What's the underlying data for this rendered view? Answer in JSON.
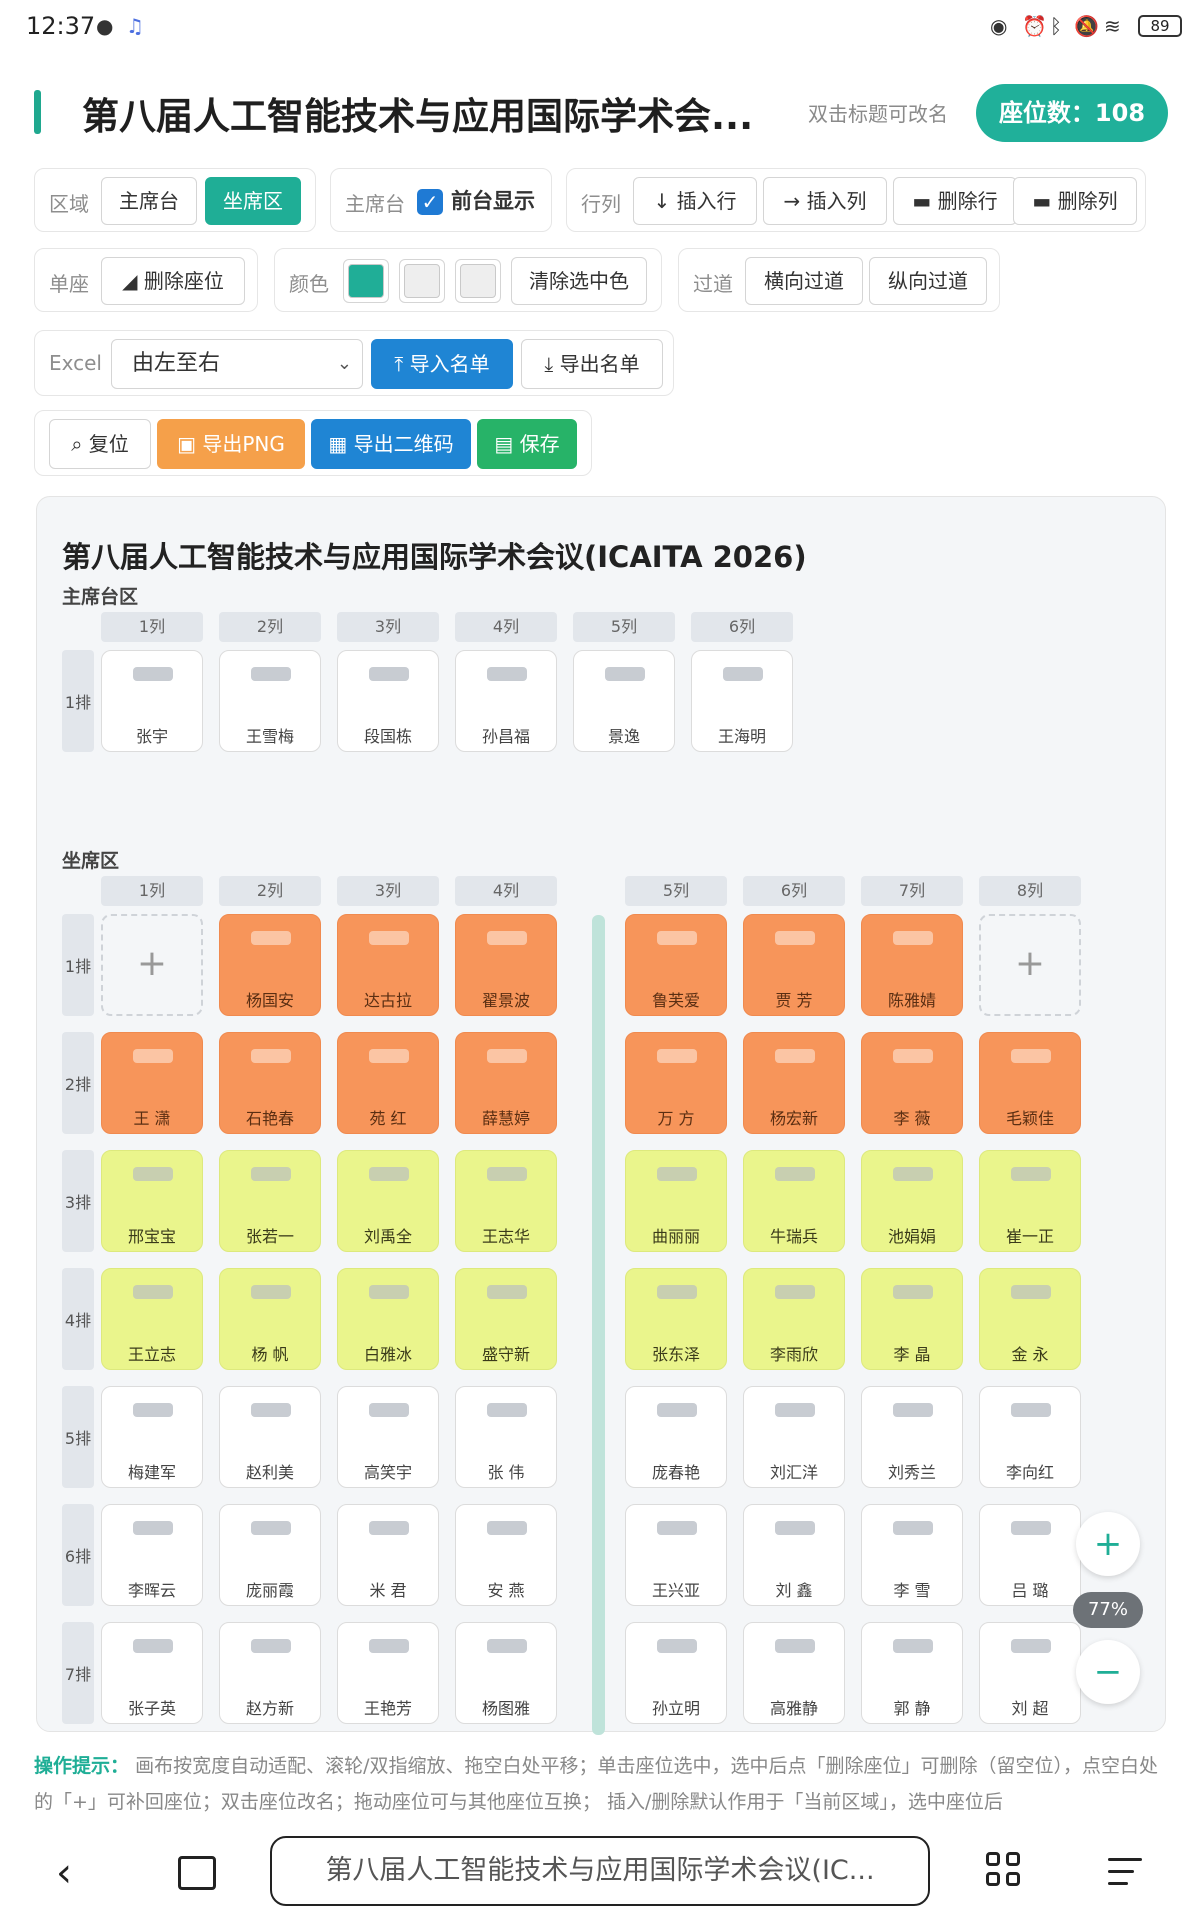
{
  "status_bar": {
    "time": "12:37",
    "battery": "89"
  },
  "header": {
    "title": "第八届人工智能技术与应用国际学术会...",
    "rename_hint": "双击标题可改名",
    "seat_count": "座位数：108"
  },
  "toolbar": {
    "area_label": "区域",
    "area_options": [
      "主席台",
      "坐席区"
    ],
    "stage_label": "主席台",
    "front_display": "前台显示",
    "rowcol_label": "行列",
    "insert_row": "插入行",
    "insert_col": "插入列",
    "delete_row": "删除行",
    "delete_col": "删除列",
    "single_label": "单座",
    "delete_seat": "删除座位",
    "color_label": "颜色",
    "colors": [
      "#20ae97",
      "#eeeeee",
      "#eeeeee"
    ],
    "clear_color": "清除选中色",
    "aisle_label": "过道",
    "h_aisle": "横向过道",
    "v_aisle": "纵向过道",
    "excel_label": "Excel",
    "direction": "由左至右",
    "import_list": "导入名单",
    "export_list": "导出名单",
    "reset": "复位",
    "export_png": "导出PNG",
    "export_qr": "导出二维码",
    "save": "保存"
  },
  "canvas": {
    "title": "第八届人工智能技术与应用国际学术会议(ICAITA 2026)",
    "stage": {
      "label": "主席台区",
      "columns": [
        "1列",
        "2列",
        "3列",
        "4列",
        "5列",
        "6列"
      ],
      "rows": [
        {
          "label": "1排",
          "seats": [
            {
              "name": "张宇",
              "color": "white"
            },
            {
              "name": "王雪梅",
              "color": "white"
            },
            {
              "name": "段国栋",
              "color": "white"
            },
            {
              "name": "孙昌福",
              "color": "white"
            },
            {
              "name": "景逸",
              "color": "white"
            },
            {
              "name": "王海明",
              "color": "white"
            }
          ]
        }
      ]
    },
    "seating": {
      "label": "坐席区",
      "columns": [
        "1列",
        "2列",
        "3列",
        "4列",
        "5列",
        "6列",
        "7列",
        "8列"
      ],
      "rows": [
        {
          "label": "1排",
          "seats": [
            {
              "name": "",
              "color": "empty"
            },
            {
              "name": "杨国安",
              "color": "orange"
            },
            {
              "name": "达古拉",
              "color": "orange"
            },
            {
              "name": "翟景波",
              "color": "orange"
            },
            {
              "name": "鲁芙爱",
              "color": "orange"
            },
            {
              "name": "贾 芳",
              "color": "orange"
            },
            {
              "name": "陈雅婧",
              "color": "orange"
            },
            {
              "name": "",
              "color": "empty"
            }
          ]
        },
        {
          "label": "2排",
          "seats": [
            {
              "name": "王 潇",
              "color": "orange"
            },
            {
              "name": "石艳春",
              "color": "orange"
            },
            {
              "name": "苑 红",
              "color": "orange"
            },
            {
              "name": "薛慧婷",
              "color": "orange"
            },
            {
              "name": "万 方",
              "color": "orange"
            },
            {
              "name": "杨宏新",
              "color": "orange"
            },
            {
              "name": "李 薇",
              "color": "orange"
            },
            {
              "name": "毛颖佳",
              "color": "orange"
            }
          ]
        },
        {
          "label": "3排",
          "seats": [
            {
              "name": "邢宝宝",
              "color": "yellow"
            },
            {
              "name": "张若一",
              "color": "yellow"
            },
            {
              "name": "刘禹全",
              "color": "yellow"
            },
            {
              "name": "王志华",
              "color": "yellow"
            },
            {
              "name": "曲丽丽",
              "color": "yellow"
            },
            {
              "name": "牛瑞兵",
              "color": "yellow"
            },
            {
              "name": "池娟娟",
              "color": "yellow"
            },
            {
              "name": "崔一正",
              "color": "yellow"
            }
          ]
        },
        {
          "label": "4排",
          "seats": [
            {
              "name": "王立志",
              "color": "yellow"
            },
            {
              "name": "杨 帆",
              "color": "yellow"
            },
            {
              "name": "白雅冰",
              "color": "yellow"
            },
            {
              "name": "盛守新",
              "color": "yellow"
            },
            {
              "name": "张东泽",
              "color": "yellow"
            },
            {
              "name": "李雨欣",
              "color": "yellow"
            },
            {
              "name": "李 晶",
              "color": "yellow"
            },
            {
              "name": "金 永",
              "color": "yellow"
            }
          ]
        },
        {
          "label": "5排",
          "seats": [
            {
              "name": "梅建军",
              "color": "white"
            },
            {
              "name": "赵利美",
              "color": "white"
            },
            {
              "name": "高笑宇",
              "color": "white"
            },
            {
              "name": "张 伟",
              "color": "white"
            },
            {
              "name": "庞春艳",
              "color": "white"
            },
            {
              "name": "刘汇洋",
              "color": "white"
            },
            {
              "name": "刘秀兰",
              "color": "white"
            },
            {
              "name": "李向红",
              "color": "white"
            }
          ]
        },
        {
          "label": "6排",
          "seats": [
            {
              "name": "李晖云",
              "color": "white"
            },
            {
              "name": "庞丽霞",
              "color": "white"
            },
            {
              "name": "米 君",
              "color": "white"
            },
            {
              "name": "安 燕",
              "color": "white"
            },
            {
              "name": "王兴亚",
              "color": "white"
            },
            {
              "name": "刘 鑫",
              "color": "white"
            },
            {
              "name": "李 雪",
              "color": "white"
            },
            {
              "name": "吕 璐",
              "color": "white"
            }
          ]
        },
        {
          "label": "7排",
          "seats": [
            {
              "name": "张子英",
              "color": "white"
            },
            {
              "name": "赵方新",
              "color": "white"
            },
            {
              "name": "王艳芳",
              "color": "white"
            },
            {
              "name": "杨图雅",
              "color": "white"
            },
            {
              "name": "孙立明",
              "color": "white"
            },
            {
              "name": "高雅静",
              "color": "white"
            },
            {
              "name": "郭 静",
              "color": "white"
            },
            {
              "name": "刘 超",
              "color": "white"
            }
          ]
        }
      ]
    },
    "zoom": "77%",
    "zoom_in": "+",
    "zoom_out": "−",
    "add_symbol": "+"
  },
  "tip": {
    "label": "操作提示：",
    "text": "画布按宽度自动适配、滚轮/双指缩放、拖空白处平移；单击座位选中，选中后点「删除座位」可删除（留空位），点空白处的「+」可补回座位；双击座位改名；拖动座位可与其他座位互换； 插入/删除默认作用于「当前区域」，选中座位后"
  },
  "browser": {
    "url_title": "第八届人工智能技术与应用国际学术会议(IC..."
  }
}
